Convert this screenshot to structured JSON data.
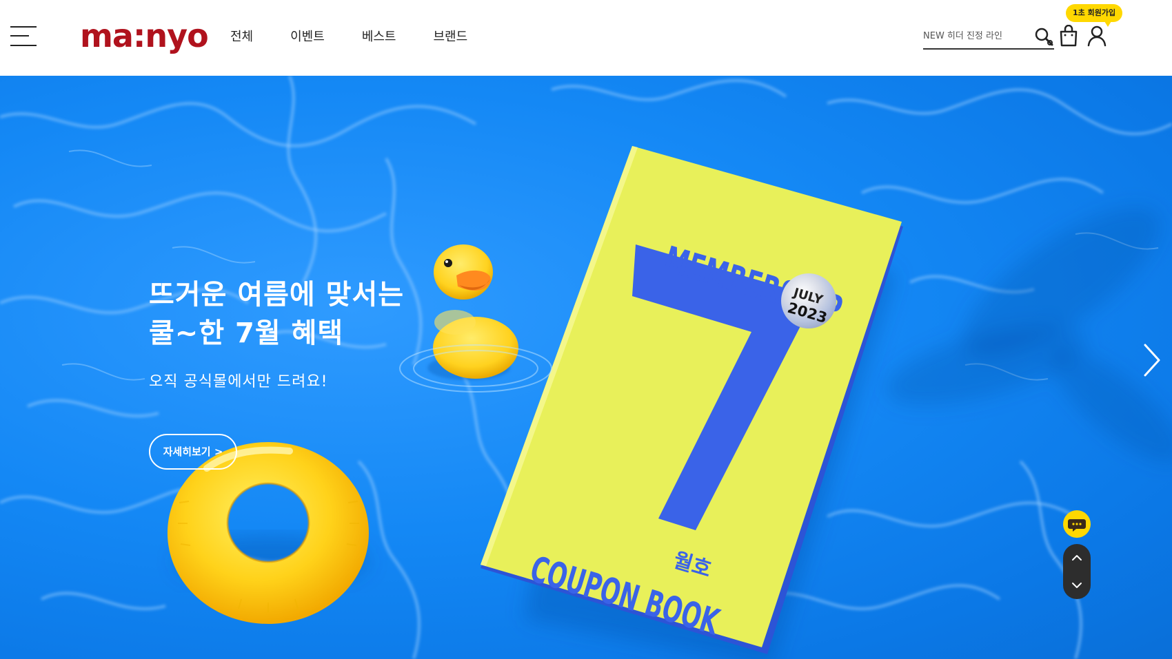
{
  "header": {
    "logo": "ma:nyo",
    "menu_icon": "hamburger-menu-icon",
    "nav": [
      {
        "label": "전체"
      },
      {
        "label": "이벤트"
      },
      {
        "label": "베스트"
      },
      {
        "label": "브랜드"
      }
    ],
    "search": {
      "placeholder": "NEW 히더 진정 라인",
      "icon": "search-icon"
    },
    "cart_icon": "shopping-bag-icon",
    "user_icon": "user-icon",
    "join_badge": "1초 회원가입"
  },
  "hero": {
    "headline_line1": "뜨거운 여름에 맞서는",
    "headline_line2": "쿨~한 7월 혜택",
    "subline": "오직 공식몰에서만 드려요!",
    "cta_label": "자세히보기 >",
    "book": {
      "top_text": "MEMBERSHIP",
      "big_number": "7",
      "issue_label": "월호",
      "sticker_month": "JULY",
      "sticker_year": "2023",
      "bottom_text": "COUPON BOOK"
    },
    "next_icon": "chevron-right-icon"
  },
  "floating": {
    "chat_icon": "chat-bubble-icon",
    "scroll_up_icon": "chevron-up-icon",
    "scroll_down_icon": "chevron-down-icon"
  },
  "colors": {
    "brand": "#b0121d",
    "pool_blue": "#1488f5",
    "book_yellow": "#e8f05a",
    "book_blue": "#3a63e8",
    "accent_yellow": "#ffd800"
  }
}
